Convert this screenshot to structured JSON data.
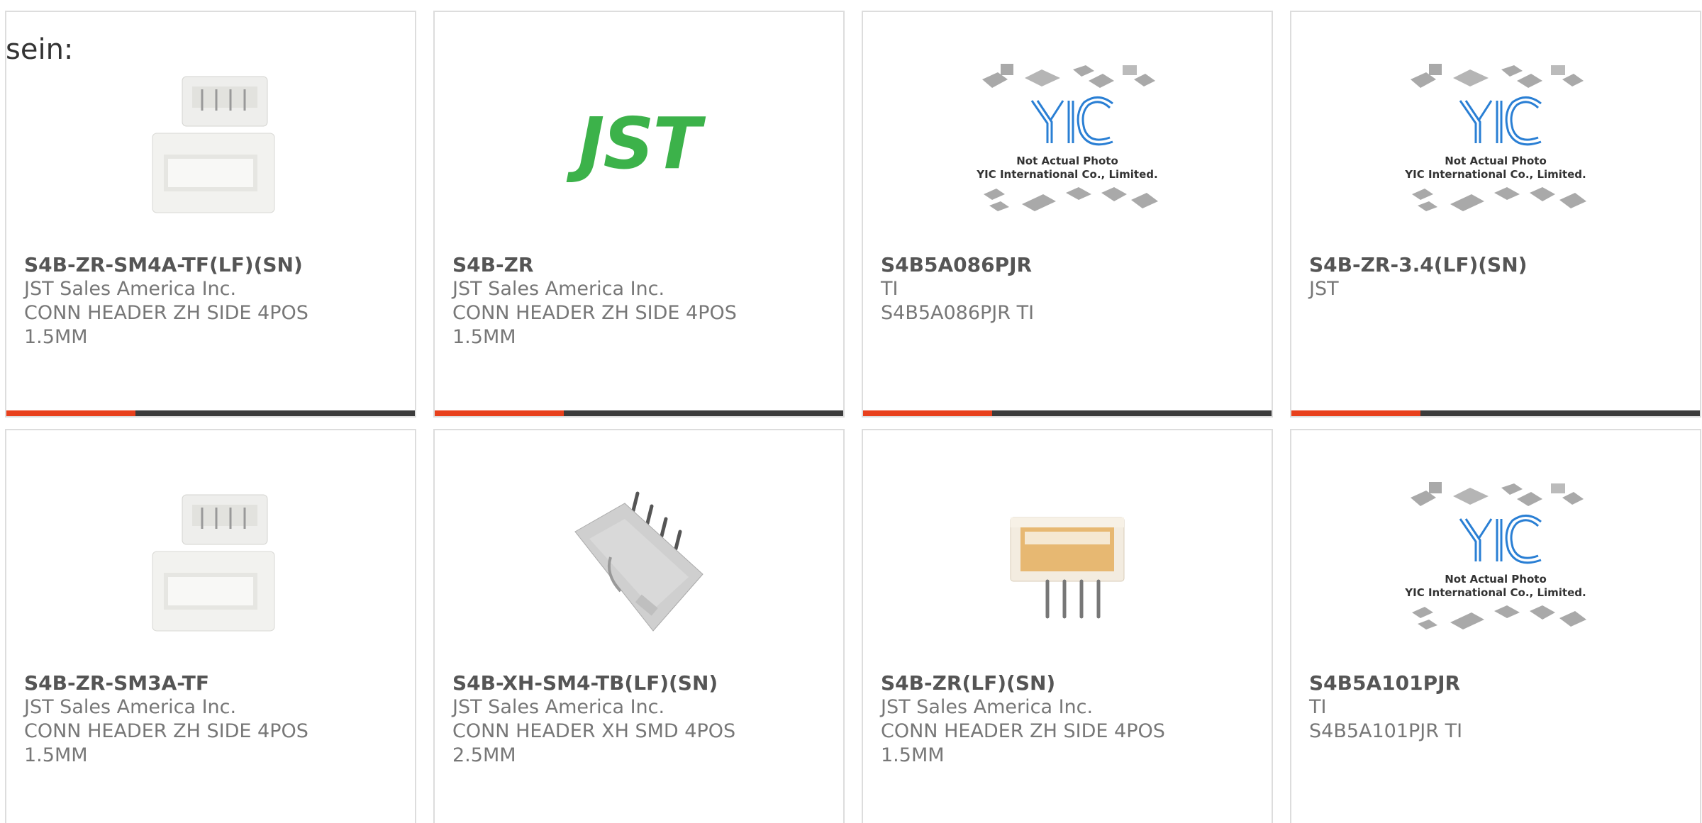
{
  "intro_text": "sein:",
  "accent_color": "#e8401c",
  "bar_color": "#3b3b3b",
  "products": [
    {
      "part_number": "S4B-ZR-SM4A-TF(LF)(SN)",
      "manufacturer": "JST Sales America Inc.",
      "description_1": "CONN HEADER ZH SIDE 4POS",
      "description_2": "1.5MM",
      "image": "zh-side-connector-photo"
    },
    {
      "part_number": "S4B-ZR",
      "manufacturer": "JST Sales America Inc.",
      "description_1": "CONN HEADER ZH SIDE 4POS",
      "description_2": "1.5MM",
      "image": "jst-logo",
      "logo_text": "JST"
    },
    {
      "part_number": "S4B5A086PJR",
      "manufacturer": "TI",
      "description_1": "S4B5A086PJR TI",
      "description_2": "",
      "image": "yic-placeholder",
      "placeholder_line_1": "Not Actual Photo",
      "placeholder_line_2": "YIC International Co., Limited."
    },
    {
      "part_number": "S4B-ZR-3.4(LF)(SN)",
      "manufacturer": "JST",
      "description_1": "",
      "description_2": "",
      "image": "yic-placeholder",
      "placeholder_line_1": "Not Actual Photo",
      "placeholder_line_2": "YIC International Co., Limited."
    },
    {
      "part_number": "S4B-ZR-SM3A-TF",
      "manufacturer": "JST Sales America Inc.",
      "description_1": "CONN HEADER ZH SIDE 4POS",
      "description_2": "1.5MM",
      "image": "zh-side-connector-photo"
    },
    {
      "part_number": "S4B-XH-SM4-TB(LF)(SN)",
      "manufacturer": "JST Sales America Inc.",
      "description_1": "CONN HEADER XH SMD 4POS",
      "description_2": "2.5MM",
      "image": "xh-smd-connector-photo"
    },
    {
      "part_number": "S4B-ZR(LF)(SN)",
      "manufacturer": "JST Sales America Inc.",
      "description_1": "CONN HEADER ZH SIDE 4POS",
      "description_2": "1.5MM",
      "image": "zh-through-hole-connector-photo"
    },
    {
      "part_number": "S4B5A101PJR",
      "manufacturer": "TI",
      "description_1": "S4B5A101PJR TI",
      "description_2": "",
      "image": "yic-placeholder",
      "placeholder_line_1": "Not Actual Photo",
      "placeholder_line_2": "YIC International Co., Limited."
    }
  ]
}
